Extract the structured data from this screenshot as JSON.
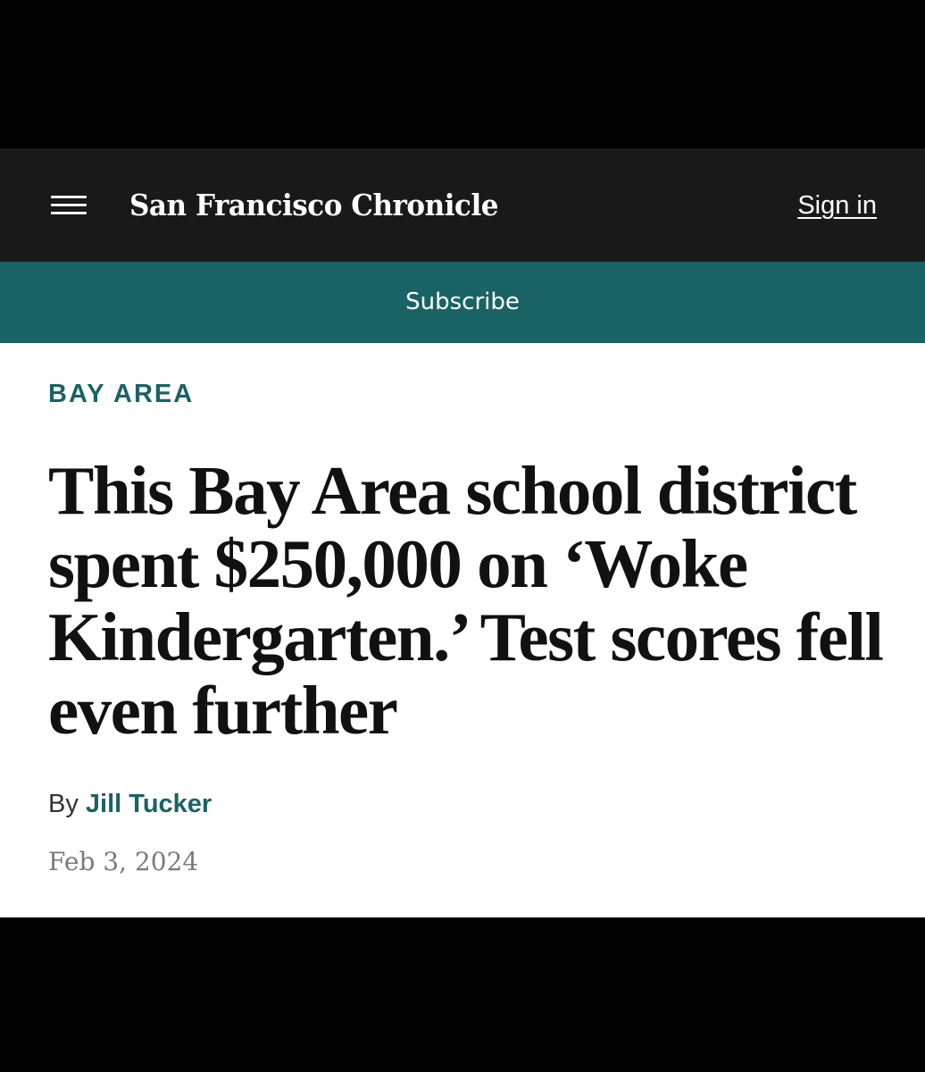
{
  "header": {
    "menu_icon": "hamburger-menu-icon",
    "logo_text": "San Francisco Chronicle",
    "signin_label": "Sign in"
  },
  "subscribe": {
    "label": "Subscribe"
  },
  "article": {
    "section": "BAY AREA",
    "headline": "This Bay Area school district spent $250,000 on ‘Woke Kindergarten.’ Test scores fell even further",
    "byline_prefix": "By",
    "author": "Jill Tucker",
    "date": "Feb 3, 2024"
  },
  "colors": {
    "header_bg": "#191919",
    "accent_teal": "#1a6365",
    "page_bg": "#000000",
    "article_bg": "#ffffff"
  }
}
